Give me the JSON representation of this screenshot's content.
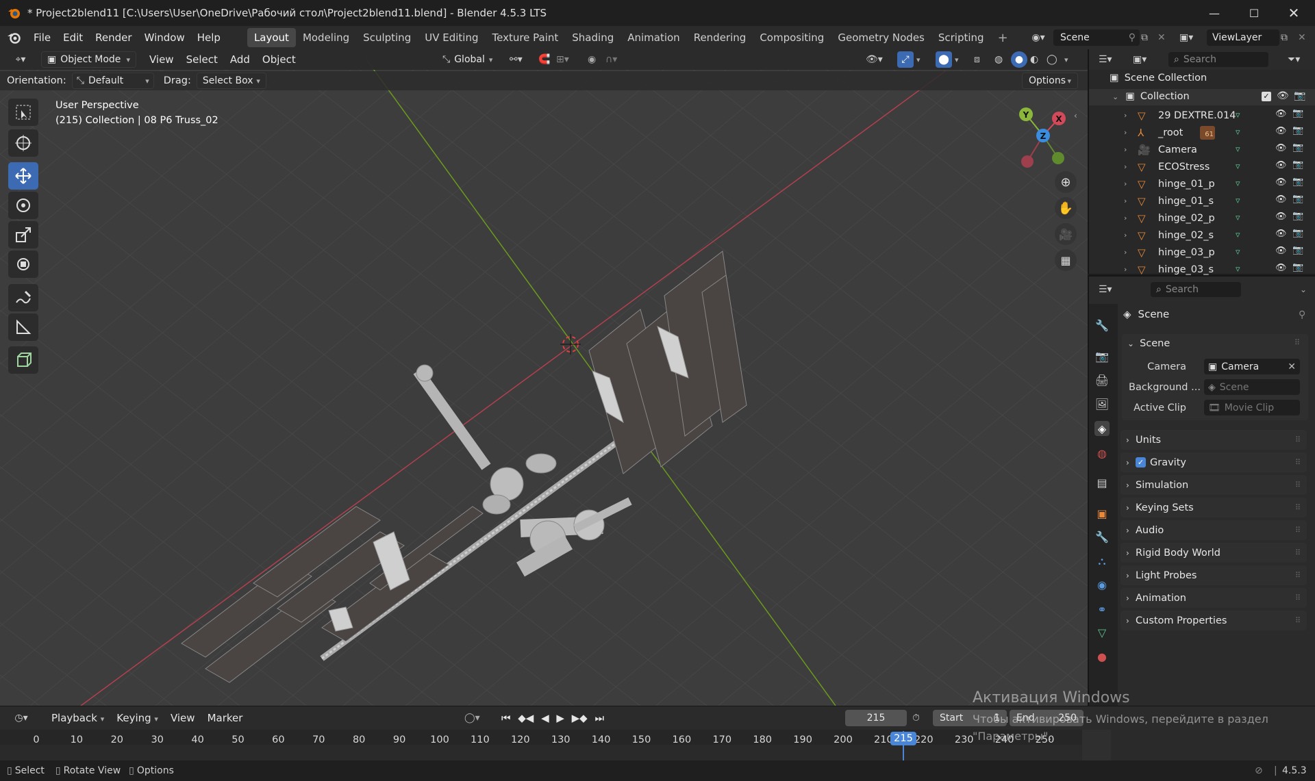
{
  "window": {
    "title": "* Project2blend11 [C:\\Users\\User\\OneDrive\\Рабочий стол\\Project2blend11.blend] - Blender 4.5.3 LTS",
    "minimize_icon": "minimize-icon",
    "maximize_icon": "maximize-icon",
    "close_icon": "close-icon"
  },
  "menu": [
    "File",
    "Edit",
    "Render",
    "Window",
    "Help"
  ],
  "workspaces": [
    "Layout",
    "Modeling",
    "Sculpting",
    "UV Editing",
    "Texture Paint",
    "Shading",
    "Animation",
    "Rendering",
    "Compositing",
    "Geometry Nodes",
    "Scripting"
  ],
  "active_workspace": "Layout",
  "scene_selector": {
    "value": "Scene"
  },
  "viewlayer_selector": {
    "value": "ViewLayer"
  },
  "viewport_header": {
    "mode": "Object Mode",
    "menus": [
      "View",
      "Select",
      "Add",
      "Object"
    ],
    "transform_orientation": "Global"
  },
  "tool_settings": {
    "orientation_label": "Orientation:",
    "orientation_value": "Default",
    "drag_label": "Drag:",
    "drag_value": "Select Box",
    "options": "Options"
  },
  "viewport_info": {
    "line1": "User Perspective",
    "line2": "(215) Collection | 08 P6 Truss_02"
  },
  "gizmo": {
    "x": "X",
    "y": "Y",
    "z": "Z"
  },
  "outliner": {
    "search_placeholder": "Search",
    "root": "Scene Collection",
    "collection": "Collection",
    "items": [
      {
        "name": "29 DEXTRE.014",
        "icon": "mesh-icon"
      },
      {
        "name": "_root",
        "icon": "armature-icon"
      },
      {
        "name": "Camera",
        "icon": "camera-icon"
      },
      {
        "name": "ECOStress",
        "icon": "mesh-icon"
      },
      {
        "name": "hinge_01_p",
        "icon": "mesh-icon"
      },
      {
        "name": "hinge_01_s",
        "icon": "mesh-icon"
      },
      {
        "name": "hinge_02_p",
        "icon": "mesh-icon"
      },
      {
        "name": "hinge_02_s",
        "icon": "mesh-icon"
      },
      {
        "name": "hinge_03_p",
        "icon": "mesh-icon"
      },
      {
        "name": "hinge_03_s",
        "icon": "mesh-icon"
      }
    ],
    "root_badge": "61"
  },
  "properties": {
    "search_placeholder": "Search",
    "context_title": "Scene",
    "scene_panel": {
      "title": "Scene",
      "camera_label": "Camera",
      "camera_value": "Camera",
      "background_label": "Background ...",
      "background_placeholder": "Scene",
      "clip_label": "Active Clip",
      "clip_placeholder": "Movie Clip"
    },
    "panels": [
      "Units",
      "Gravity",
      "Simulation",
      "Keying Sets",
      "Audio",
      "Rigid Body World",
      "Light Probes",
      "Animation",
      "Custom Properties"
    ],
    "gravity_checked": true
  },
  "timeline": {
    "menus": [
      "Playback",
      "Keying",
      "View",
      "Marker"
    ],
    "current_frame": "215",
    "start_label": "Start",
    "start_value": "1",
    "end_label": "End",
    "end_value": "250",
    "ticks": [
      "0",
      "10",
      "20",
      "30",
      "40",
      "50",
      "60",
      "70",
      "80",
      "90",
      "100",
      "110",
      "120",
      "130",
      "140",
      "150",
      "160",
      "170",
      "180",
      "190",
      "200",
      "210",
      "220",
      "230",
      "240",
      "250"
    ],
    "playhead_label": "215"
  },
  "watermark": {
    "line1": "Активация Windows",
    "line2": "Чтобы активировать Windows, перейдите в раздел",
    "line3": "\"Параметры\"."
  },
  "statusbar": {
    "select": "Select",
    "rotate": "Rotate View",
    "options": "Options",
    "version": "4.5.3"
  }
}
